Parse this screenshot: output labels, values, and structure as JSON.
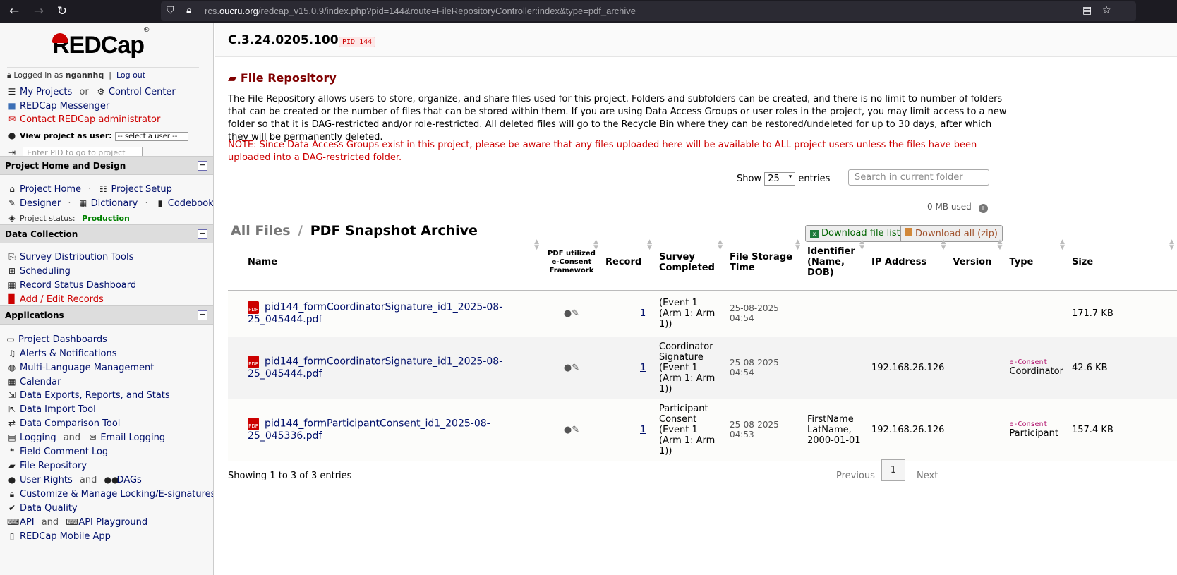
{
  "browser": {
    "url_host_pre": "rcs.",
    "url_host": "oucru.org",
    "url_path": "/redcap_v15.0.9/index.php?pid=144&route=FileRepositoryController:index&type=pdf_archive"
  },
  "sidebar": {
    "logo": "REDCap",
    "logged_in_prefix": "Logged in as",
    "username": "ngannhq",
    "logout": "Log out",
    "my_projects": "My Projects",
    "or": "or",
    "control_center": "Control Center",
    "messenger": "REDCap Messenger",
    "contact": "Contact REDCap administrator",
    "view_as_label": "View project as user:",
    "view_as_value": "-- select a user --",
    "pid_placeholder": "Enter PID to go to project",
    "sections": {
      "home_design": "Project Home and Design",
      "data_collection": "Data Collection",
      "applications": "Applications"
    },
    "project_home": "Project Home",
    "project_setup": "Project Setup",
    "designer": "Designer",
    "dictionary": "Dictionary",
    "codebook": "Codebook",
    "status_label": "Project status:",
    "status_value": "Production",
    "dc_items": [
      "Survey Distribution Tools",
      "Scheduling",
      "Record Status Dashboard",
      "Add / Edit Records"
    ],
    "apps": {
      "project_dashboards": "Project Dashboards",
      "alerts": "Alerts & Notifications",
      "mlm": "Multi-Language Management",
      "calendar": "Calendar",
      "exports": "Data Exports, Reports, and Stats",
      "import": "Data Import Tool",
      "comparison": "Data Comparison Tool",
      "logging": "Logging",
      "and": "and",
      "email_logging": "Email Logging",
      "field_comment": "Field Comment Log",
      "file_repo": "File Repository",
      "user_rights": "User Rights",
      "dags": "DAGs",
      "locking": "Customize & Manage Locking/E-signatures",
      "data_quality": "Data Quality",
      "api": "API",
      "api_playground": "API Playground",
      "mobile_app": "REDCap Mobile App"
    }
  },
  "header": {
    "project_title": "C.3.24.0205.100",
    "pid_badge": "PID 144"
  },
  "page": {
    "title": "File Repository",
    "description": "The File Repository allows users to store, organize, and share files used for this project. Folders and subfolders can be created, and there is no limit to number of folders that can be created or the number of files that can be stored within them. If you are using Data Access Groups or user roles in the project, you may limit access to a new folder so that it is DAG-restricted and/or role-restricted. All deleted files will go to the Recycle Bin where they can be restored/undeleted for up to 30 days, after which they will be permanently deleted.",
    "note": "NOTE: Since Data Access Groups exist in this project, please be aware that any files uploaded here will be available to ALL project users unless the files have been uploaded into a DAG-restricted folder.",
    "show_label": "Show",
    "show_value": "25",
    "entries_label": "entries",
    "search_placeholder": "Search in current folder",
    "used": "0 MB used",
    "breadcrumb_root": "All Files",
    "breadcrumb_sep": "/",
    "breadcrumb_current": "PDF Snapshot Archive",
    "download_list": "Download file list",
    "download_all": "Download all (zip)",
    "footer_info": "Showing 1 to 3 of 3 entries",
    "prev": "Previous",
    "page_num": "1",
    "next": "Next"
  },
  "table": {
    "headers": [
      "Name",
      "PDF utilized e-Consent Framework",
      "Record",
      "Survey Completed",
      "File Storage Time",
      "Identifier (Name, DOB)",
      "IP Address",
      "Version",
      "Type",
      "Size"
    ],
    "rows": [
      {
        "name": "pid144_formCoordinatorSignature_id1_2025-08-25_045444.pdf",
        "record": "1",
        "survey": "(Event 1 (Arm 1: Arm 1))",
        "time": "25-08-2025 04:54",
        "identifier": "",
        "ip": "",
        "version": "",
        "type_tag": "",
        "type": "",
        "size": "171.7 KB"
      },
      {
        "name": "pid144_formCoordinatorSignature_id1_2025-08-25_045444.pdf",
        "record": "1",
        "survey": "Coordinator Signature (Event 1 (Arm 1: Arm 1))",
        "time": "25-08-2025 04:54",
        "identifier": "",
        "ip": "192.168.26.126",
        "version": "",
        "type_tag": "e-Consent",
        "type": "Coordinator",
        "size": "42.6 KB"
      },
      {
        "name": "pid144_formParticipantConsent_id1_2025-08-25_045336.pdf",
        "record": "1",
        "survey": "Participant Consent (Event 1 (Arm 1: Arm 1))",
        "time": "25-08-2025 04:53",
        "identifier": "FirstName LatName, 2000-01-01",
        "ip": "192.168.26.126",
        "version": "",
        "type_tag": "e-Consent",
        "type": "Participant",
        "size": "157.4 KB"
      }
    ]
  }
}
